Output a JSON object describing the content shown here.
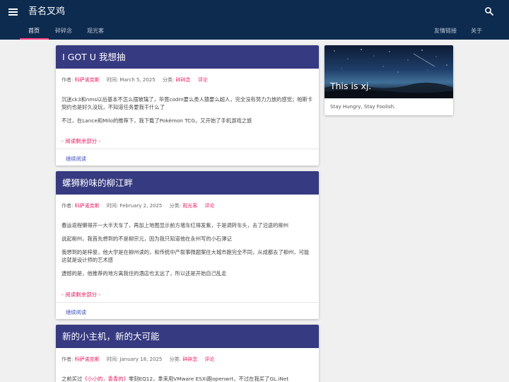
{
  "header": {
    "site_title": "吾名叉鸡",
    "tabs": [
      {
        "label": "首页",
        "active": true
      },
      {
        "label": "碎碎念",
        "active": false
      },
      {
        "label": "观光客",
        "active": false
      },
      {
        "label": "友情链接",
        "active": false
      },
      {
        "label": "关于",
        "active": false
      }
    ],
    "icons": {
      "menu": "menu-icon",
      "search": "search-icon"
    },
    "bar_color": "#0d2b4f",
    "active_indicator_color": "#ff4081"
  },
  "posts": [
    {
      "title": "I GOT U 我想抽",
      "author_label": "作者:",
      "author": "科萨诺克斯",
      "time_label": "时间:",
      "date": "March 5, 2025",
      "category_label": "分类:",
      "category": "碎碎念",
      "comments": "评论",
      "paragraphs": [
        "沉迷ck3和nms以后基本不怎么摆玻璃了，毕竟codm要么类人猿要么超人，完全没有努力力放的感觉；帕斯卡契约也是好久没玩，不知道任务要我干什么了",
        "不过，在Lance和Milo的推荐下，我下载了Pokémon  TCG，又开始了手机游戏之旅"
      ],
      "read_more": "- 阅读剩余部分 -",
      "continue": "继续阅读"
    },
    {
      "title": "螺狮粉味的柳江畔",
      "author_label": "作者:",
      "author": "科萨诺克斯",
      "time_label": "时间:",
      "date": "February 2, 2025",
      "category_label": "分类:",
      "category": "观光客",
      "comments": "评论",
      "paragraphs": [
        "春运返程懒得开一大半天车了，再加上地图显示前方堵车红得发紫，于是调转车头，去了沿途的柳州",
        "说起柳州，我首先想到的不是柳宗元，因为我只知道他在永州写的小石潭记",
        "我想到的是梓俊，他大学是在柳州读的，和传统中产叙事微题案往大城市跑完全不同，从成都去了柳州，可能这就是设计师的艺术感",
        "遗憾的是，他推荐的地方离我住的酒店也太远了，所以还是开始自己乱走"
      ],
      "read_more": "- 阅读剩余部分 -",
      "continue": "继续阅读"
    },
    {
      "title": "新的小主机，新的大可能",
      "author_label": "作者:",
      "author": "科萨诺克斯",
      "time_label": "时间:",
      "date": "January 18, 2025",
      "category_label": "分类:",
      "category": "碎碎念",
      "comments": "评论",
      "intro_prefix": "之前买过",
      "intro_link": "《小小的，香香的》",
      "intro_suffix": "零刻EQ12，拿来用VMware ESXi跑openwrt，不过在我买了GL.iNet"
    }
  ],
  "sidebar": {
    "title": "This is xj.",
    "subtitle": "Stay Hungry, Stay Foolish."
  },
  "colors": {
    "card_header": "#363a80",
    "accent_pink": "#e91e63",
    "link_blue": "#3f51b5",
    "page_bg": "#f0f0f0"
  }
}
